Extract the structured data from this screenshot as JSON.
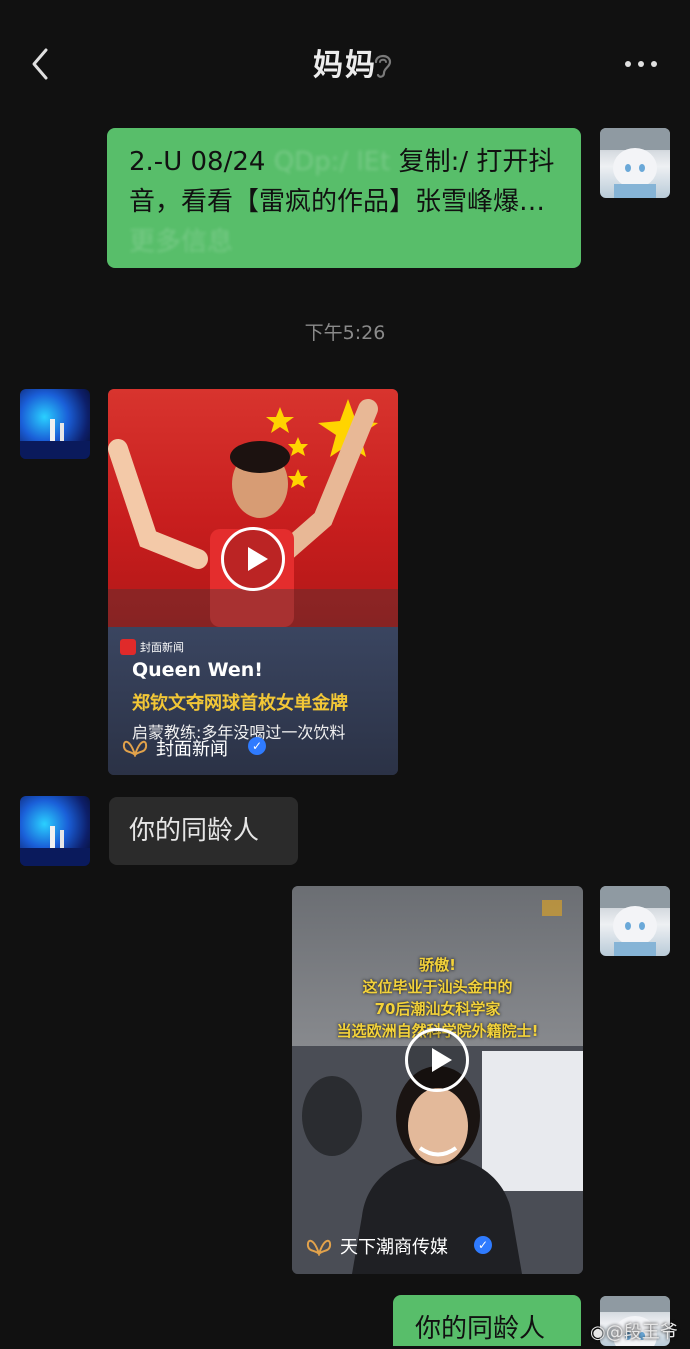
{
  "header": {
    "title": "妈妈",
    "back_icon": "chevron-left-icon",
    "ear_icon": "ear-icon",
    "more_icon": "more-dots-icon"
  },
  "messages": {
    "m1": {
      "text_start": "2.-U 08/24 ",
      "text_blurred": "QDp:/ lEt",
      "text_mid": " 复制:/ 打开抖音，看看【雷疯的作品】张雪峰爆…",
      "text_end": "更多信息"
    },
    "timestamp": "下午5:26",
    "card1": {
      "logo_label": "封面新闻",
      "headline": "Queen Wen!",
      "subhead": "郑钦文夺网球首枚女单金牌",
      "subline": "启蒙教练:多年没喝过一次饮料",
      "source": "封面新闻"
    },
    "m3": {
      "text": "你的同龄人"
    },
    "card2": {
      "line1": "骄傲!",
      "line2": "这位毕业于汕头金中的",
      "line3": "70后潮汕女科学家",
      "line4": "当选欧洲自然科学院外籍院士!",
      "source": "天下潮商传媒"
    },
    "m5": {
      "text": "你的同龄人"
    }
  },
  "watermark": {
    "text": "@段王爷"
  },
  "colors": {
    "background": "#111111",
    "bubble_green": "#58be6a",
    "bubble_dark": "#2b2b2b",
    "verified": "#2f7bff"
  }
}
